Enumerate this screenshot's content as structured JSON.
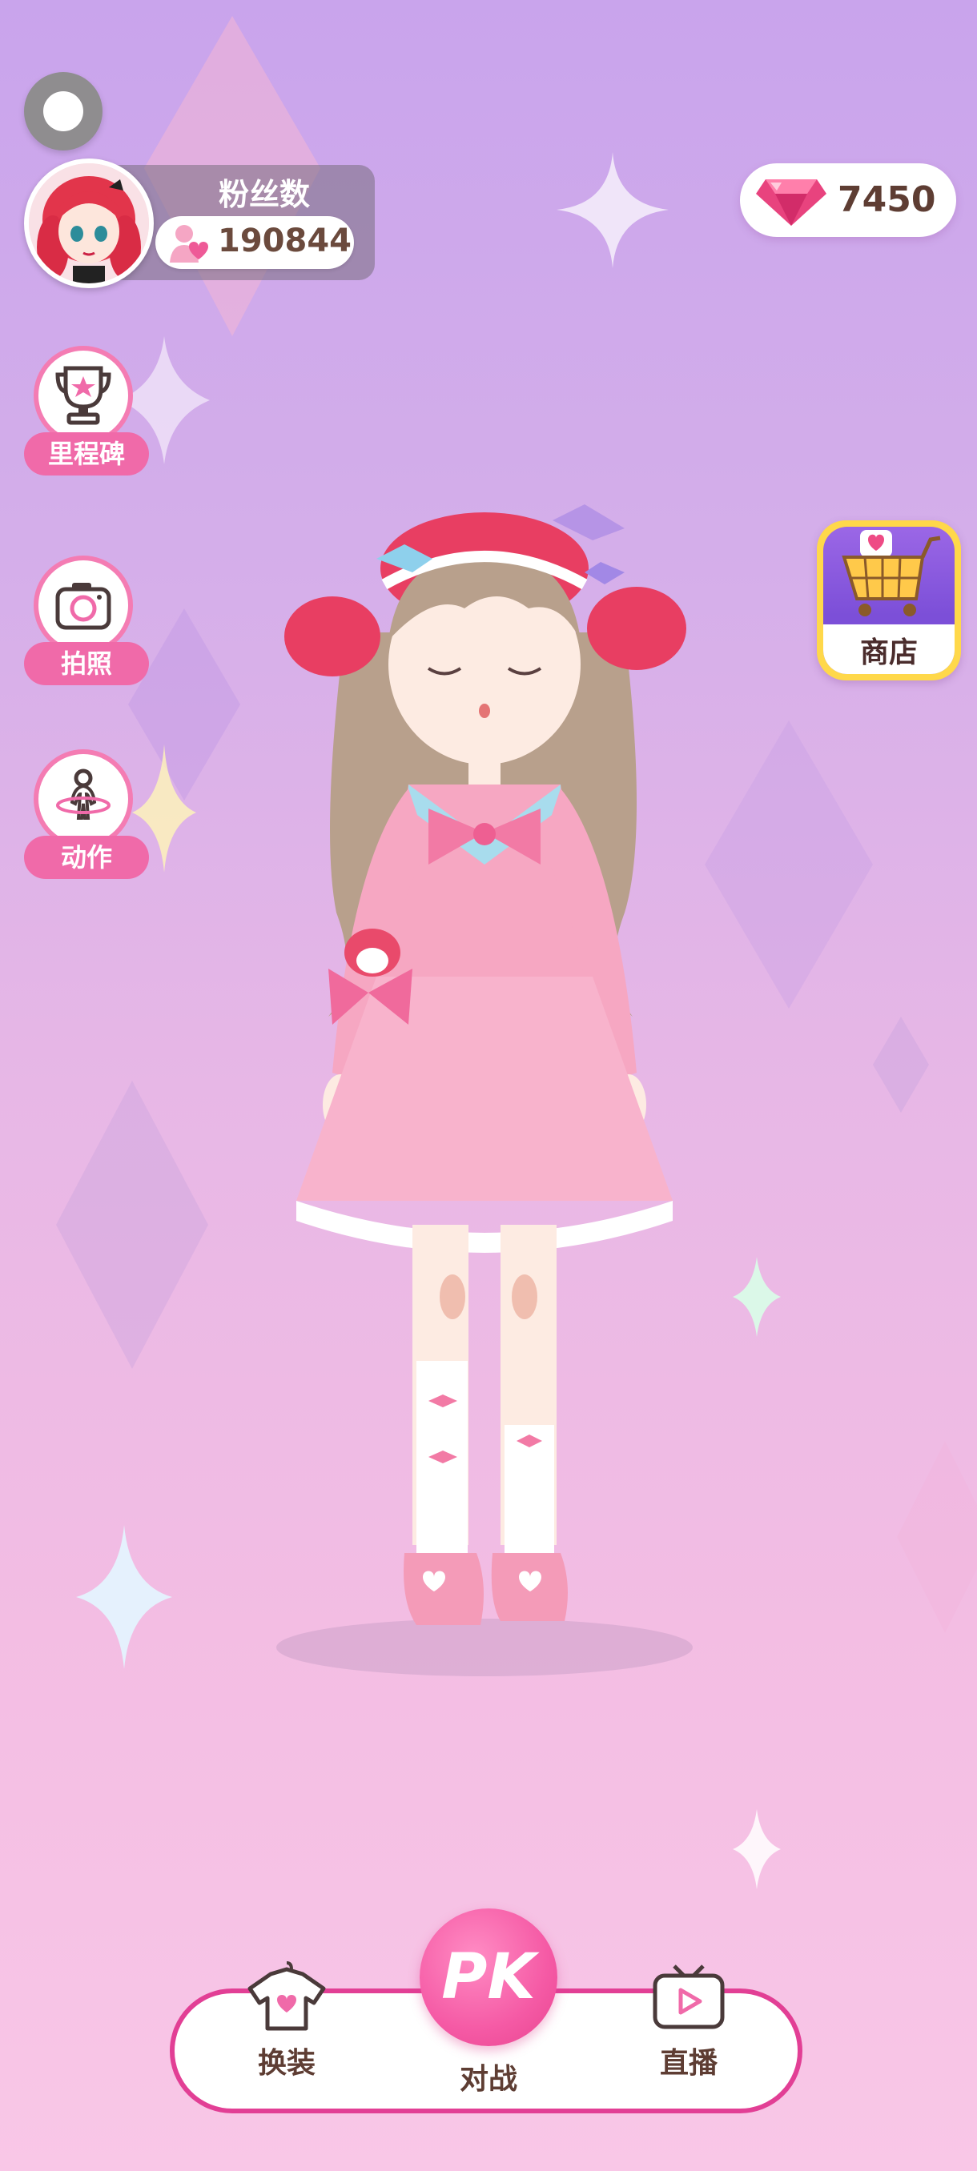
{
  "profile": {
    "fans_title": "粉丝数",
    "fans_count": "190844"
  },
  "currency": {
    "gems": "7450",
    "gem_icon": "gem-icon"
  },
  "side_menu": [
    {
      "label": "里程碑",
      "icon": "trophy-icon"
    },
    {
      "label": "拍照",
      "icon": "camera-icon"
    },
    {
      "label": "动作",
      "icon": "pose-icon"
    }
  ],
  "shop": {
    "label": "商店",
    "icon": "shopping-cart-icon"
  },
  "bottom_nav": {
    "dress_up": "换装",
    "battle_icon_text": "PK",
    "battle": "对战",
    "live": "直播"
  },
  "colors": {
    "accent_pink": "#f06aa9",
    "border_pink": "#e23f95",
    "gold": "#ffd84a"
  }
}
